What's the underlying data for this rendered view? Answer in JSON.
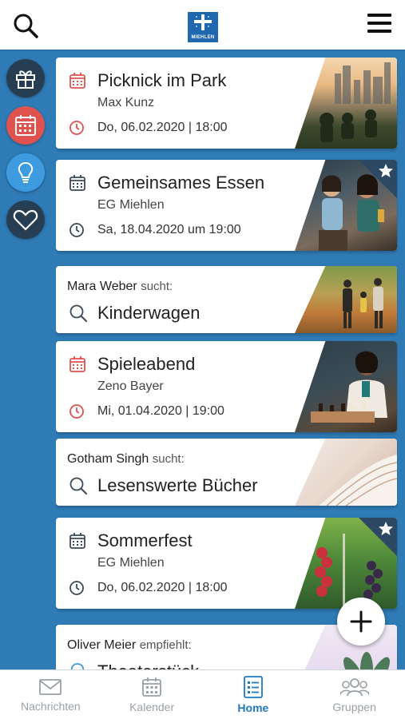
{
  "topbar": {
    "logo_text": "MIEHLEN",
    "search_icon": "search-icon",
    "menu_icon": "hamburger-menu-icon"
  },
  "side_nav": [
    {
      "icon": "gift-icon",
      "color": "#263d52"
    },
    {
      "icon": "calendar-icon",
      "color": "#e0524d"
    },
    {
      "icon": "lightbulb-icon",
      "color": "#3d9be0"
    },
    {
      "icon": "heart-icon",
      "color": "#263d52"
    }
  ],
  "feed": {
    "event1": {
      "title": "Picknick im Park",
      "host": "Max Kunz",
      "date": "Do, 06.02.2020 | 18:00",
      "accent": "#e0524d",
      "starred": false
    },
    "event2": {
      "title": "Gemeinsames Essen",
      "host": "EG Miehlen",
      "date": "Sa, 18.04.2020 um 19:00",
      "accent": "#3b4a5a",
      "starred": true
    },
    "search1": {
      "person": "Mara Weber",
      "verb": "sucht:",
      "item": "Kinderwagen"
    },
    "event3": {
      "title": "Spieleabend",
      "host": "Zeno Bayer",
      "date": "Mi, 01.04.2020 | 19:00",
      "accent": "#e0524d",
      "starred": false
    },
    "search2": {
      "person": "Gotham Singh",
      "verb": "sucht:",
      "item": "Lesenswerte Bücher"
    },
    "event4": {
      "title": "Sommerfest",
      "host": "EG Miehlen",
      "date": "Do, 06.02.2020 | 18:00",
      "accent": "#3b4a5a",
      "starred": true
    },
    "recommend": {
      "person": "Oliver Meier",
      "verb": "empfiehlt:",
      "item": "Theaterstück"
    }
  },
  "fab_icon": "plus-icon",
  "bottom_nav": {
    "nachrichten": "Nachrichten",
    "kalender": "Kalender",
    "home": "Home",
    "gruppen": "Gruppen"
  }
}
